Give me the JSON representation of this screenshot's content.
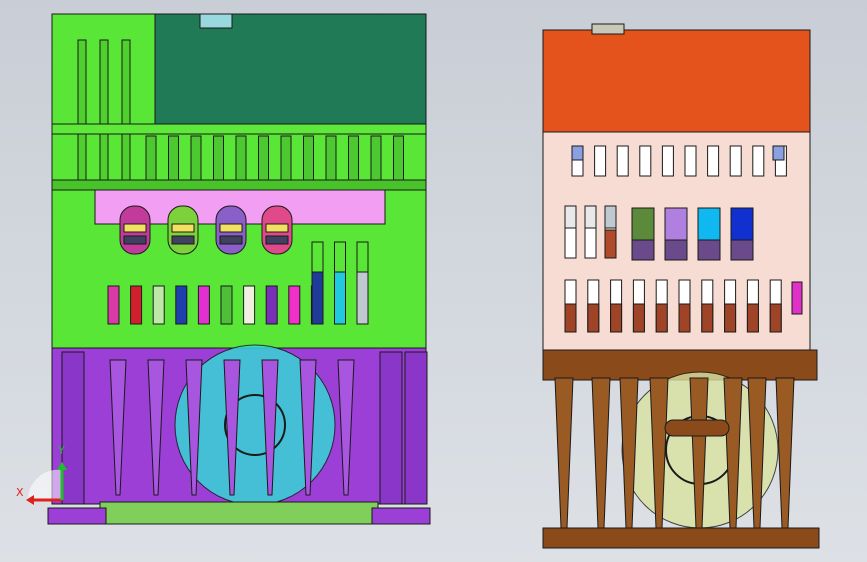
{
  "viewport": {
    "background_top": "#c9ced6",
    "background_bottom": "#dde1e6"
  },
  "axes": {
    "x_label": "X",
    "y_label": "Y",
    "x_color": "#e0201c",
    "y_color": "#1fbf2a"
  },
  "front_view": {
    "upper_color": "#59e636",
    "lower_color": "#9b3fd6",
    "cover_color": "#1f7a55",
    "panel_color": "#f29ef2",
    "fan_color": "#37d6d6",
    "base_color": "#7fcf5a",
    "connector_colors": [
      "#c23a9a",
      "#7dd13a",
      "#8a5fc8",
      "#e04a8a"
    ],
    "slot_colors": [
      "#d93aa8",
      "#d21f2e",
      "#bfe8a8",
      "#1f3fae",
      "#e030d0",
      "#4fbf3a",
      "#f0f0e0",
      "#7a2fb8",
      "#f030c8",
      "#d82030"
    ],
    "tall_slot_colors": [
      "#1f3a98",
      "#20c8e0",
      "#c0c8d0"
    ]
  },
  "side_view": {
    "top_color": "#e4531c",
    "body_color": "#f6dcd2",
    "lower_color": "#8b4a1a",
    "fan_color": "#d9e3a0",
    "module_colors": [
      "#5a8a3a",
      "#b080e0",
      "#10b8f0",
      "#1030d0"
    ],
    "slot_colors": [
      "#e8e8e8",
      "#c0c8d0",
      "#b04a2a"
    ],
    "accent_color": "#e030c8"
  }
}
